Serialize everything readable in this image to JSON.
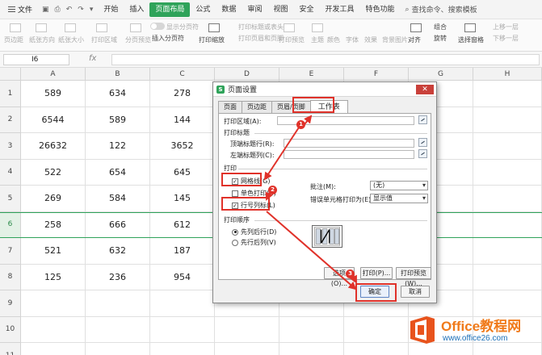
{
  "menu": {
    "file": "文件",
    "items": [
      "开始",
      "插入",
      "页面布局",
      "公式",
      "数据",
      "审阅",
      "视图",
      "安全",
      "开发工具",
      "特色功能"
    ],
    "active_index": 2,
    "search": "查找命令、搜索模板"
  },
  "ribbon": {
    "margin": "页边距",
    "orientation": "纸张方向",
    "size": "纸张大小",
    "print_area": "打印区域",
    "preview": "分页预览",
    "show_breaks": "显示分页符",
    "insert_break": "插入分页符",
    "print_title": "打印标题或表头",
    "print_header_footer": "打印页眉和页脚",
    "print_zoom": "打印缩放",
    "print_preview": "打印预览",
    "theme": "主题",
    "color": "颜色",
    "font": "字体",
    "effect": "效果",
    "background": "背景图片",
    "align": "对齐",
    "rotate": "旋转",
    "group": "组合",
    "select_pane": "选择窗格",
    "up_one": "上移一层",
    "down_one": "下移一层"
  },
  "formula_bar": {
    "name_box": "I6",
    "fx": "fx"
  },
  "grid": {
    "columns": [
      "A",
      "B",
      "C",
      "D",
      "E",
      "F",
      "G",
      "H"
    ],
    "rows": [
      "1",
      "2",
      "3",
      "4",
      "5",
      "6",
      "7",
      "8",
      "9",
      "10",
      "11"
    ],
    "selected_row": "6",
    "data": [
      [
        "589",
        "634",
        "278"
      ],
      [
        "6544",
        "589",
        "144"
      ],
      [
        "26632",
        "122",
        "3652"
      ],
      [
        "522",
        "654",
        "645"
      ],
      [
        "269",
        "584",
        "145"
      ],
      [
        "258",
        "666",
        "612"
      ],
      [
        "521",
        "632",
        "187"
      ],
      [
        "125",
        "236",
        "954"
      ]
    ]
  },
  "dialog": {
    "title": "页面设置",
    "close": "✕",
    "tabs": [
      "页面",
      "页边距",
      "页眉/页脚",
      "工作表"
    ],
    "active_tab": 3,
    "print_area": "打印区域(A):",
    "print_titles": "打印标题",
    "top_rows": "顶端标题行(R):",
    "left_cols": "左端标题列(C):",
    "print_section": "打印",
    "gridlines": "网格线(G)",
    "mono": "单色打印(B)",
    "row_col_headers": "行号列标(L)",
    "comments_label": "批注(M):",
    "comments_value": "(无)",
    "errors_label": "错误单元格打印为(E):",
    "errors_value": "显示值",
    "order_section": "打印顺序",
    "down_then_over": "先列后行(D)",
    "over_then_down": "先行后列(V)",
    "options_btn": "选项(O)...",
    "print_btn": "打印(P)...",
    "preview_btn": "打印预览(W)...",
    "ok_btn": "确定",
    "cancel_btn": "取消"
  },
  "annotations": {
    "badges": [
      "1",
      "2",
      "3"
    ]
  },
  "watermark": {
    "title": "Office教程网",
    "url": "www.office26.com"
  },
  "colors": {
    "accent": "#2fa35a",
    "annotation": "#e0322a",
    "wm_orange": "#f07a1a",
    "wm_blue": "#1a6fb8"
  }
}
